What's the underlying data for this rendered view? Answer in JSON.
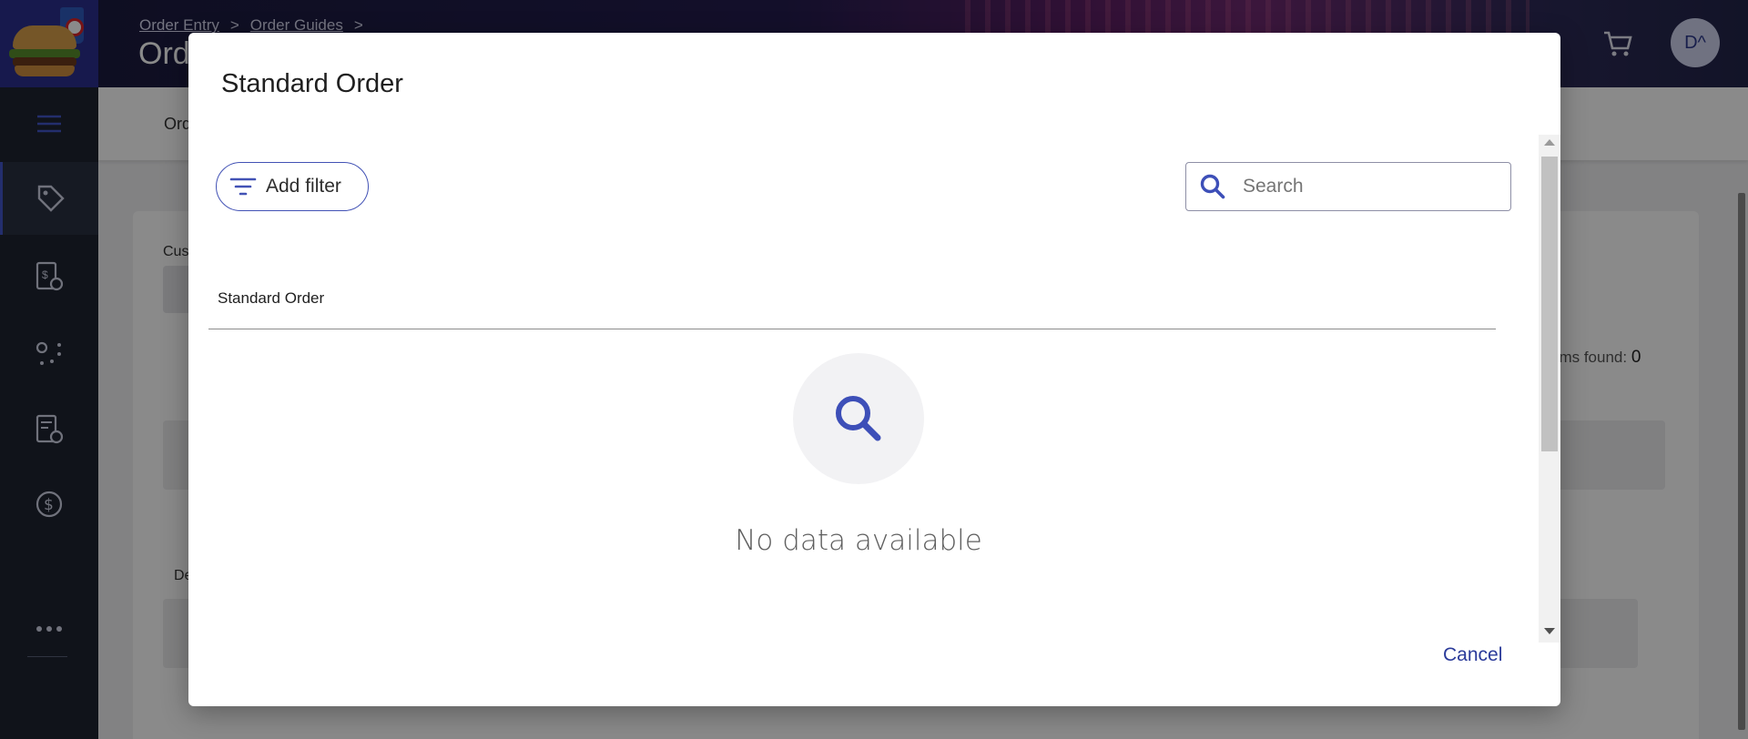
{
  "app": {
    "breadcrumbs": [
      "Order Entry",
      "Order Guides"
    ],
    "title": "Ord",
    "avatar_initials": "D^"
  },
  "sidebar": {
    "icons": [
      "menu-icon",
      "tag-icon",
      "receipt-icon",
      "route-icon",
      "invoice-icon",
      "dollar-icon",
      "more-icon"
    ]
  },
  "background": {
    "subheader_tab": "Ord",
    "customer_label": "Cus",
    "items_found_label": "ems found:",
    "items_found_count": "0",
    "detail_label": "De"
  },
  "modal": {
    "title": "Standard Order",
    "add_filter_label": "Add filter",
    "search_placeholder": "Search",
    "column_header": "Standard Order",
    "empty_message": "No data available",
    "cancel_label": "Cancel"
  },
  "colors": {
    "accent": "#4252b5",
    "link": "#2b3b9a",
    "sidebar": "#1f2430"
  }
}
